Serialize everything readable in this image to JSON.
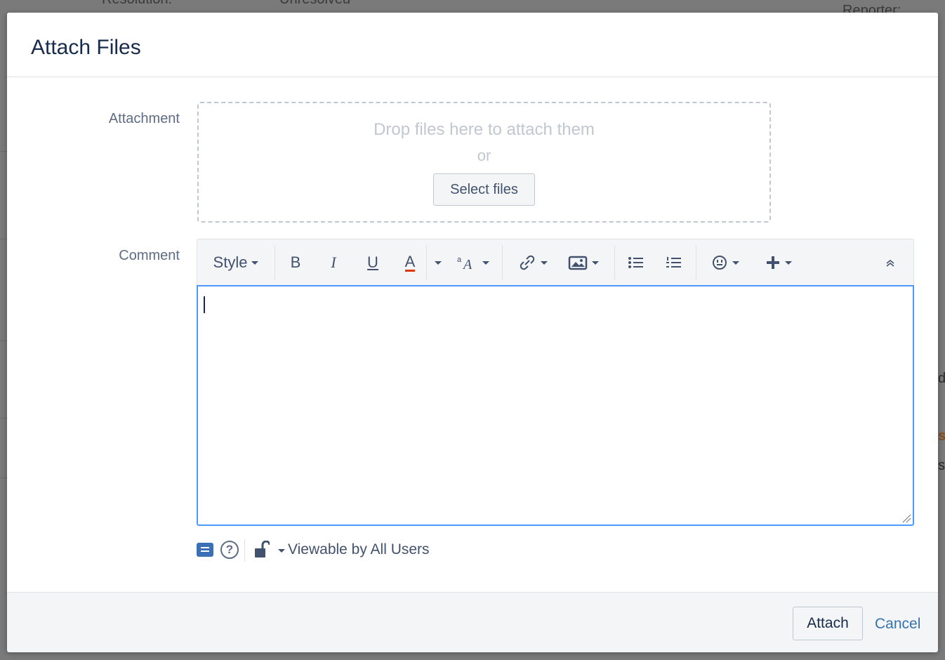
{
  "background": {
    "resolution_label": "Resolution:",
    "resolution_value": "Unresolved",
    "reporter_label": "Reporter:",
    "right_fragments": [
      "d",
      "s",
      "s"
    ]
  },
  "dialog": {
    "title": "Attach Files",
    "attachment": {
      "label": "Attachment",
      "drop_text": "Drop files here to attach them",
      "or_text": "or",
      "select_button": "Select files"
    },
    "comment": {
      "label": "Comment",
      "toolbar": {
        "style_label": "Style",
        "bold_label": "B",
        "italic_label": "I",
        "underline_label": "U",
        "text_color_label": "A",
        "text_color": "#de350b",
        "icons": [
          "text-effects-icon",
          "link-icon",
          "image-icon",
          "bullet-list-icon",
          "numbered-list-icon",
          "emoticon-icon",
          "insert-more-icon",
          "collapse-icon"
        ]
      },
      "value": ""
    },
    "visibility_label": "Viewable by All Users",
    "help_icon_glyph": "?",
    "actions": {
      "attach_label": "Attach",
      "cancel_label": "Cancel"
    }
  },
  "colors": {
    "accent": "#4c9aff",
    "link": "#3572b0",
    "wiki_icon": "#3b6fb6"
  }
}
